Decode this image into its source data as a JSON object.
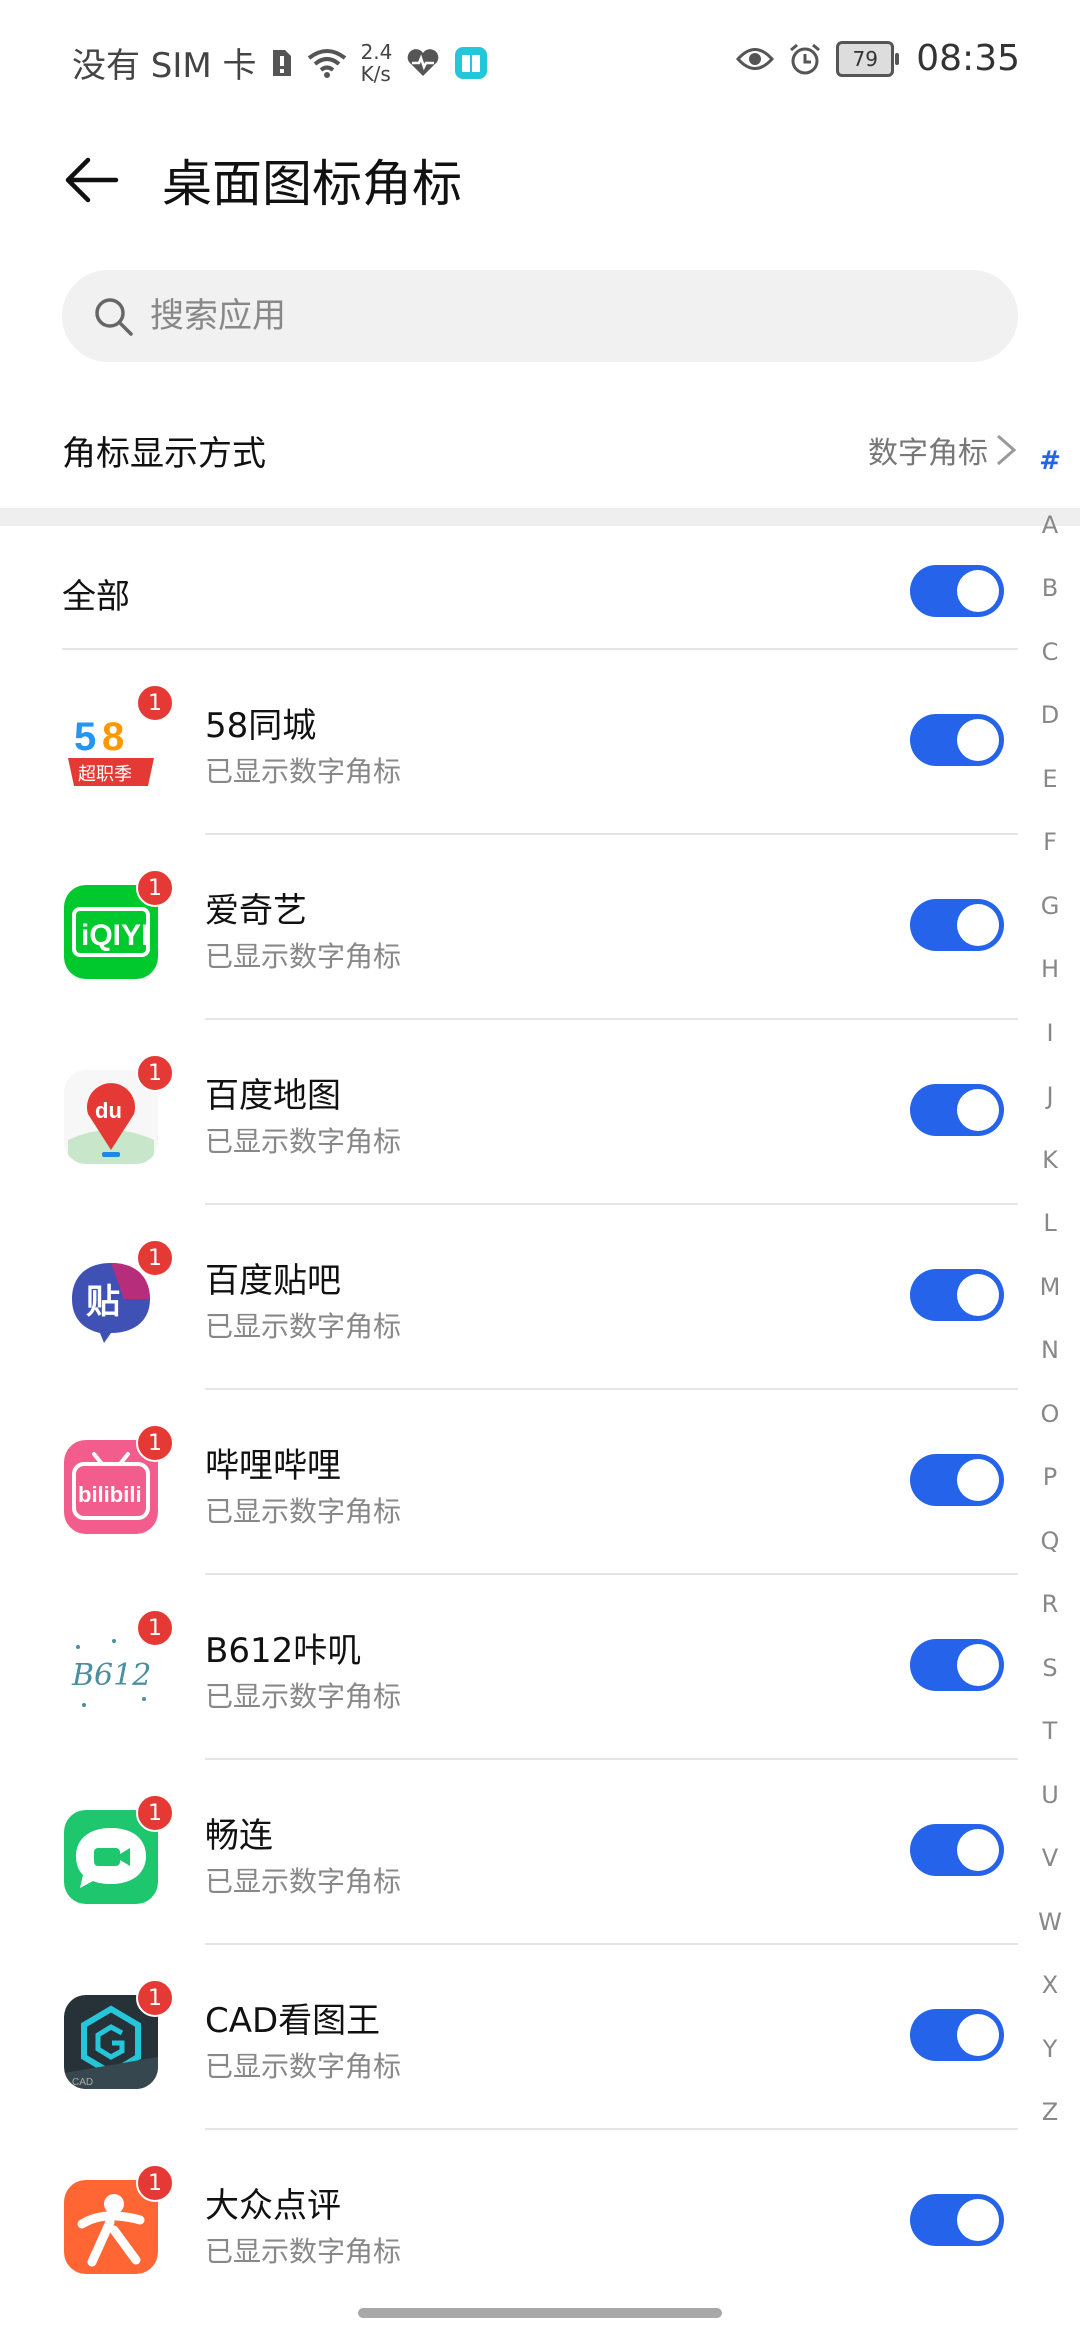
{
  "status": {
    "carrier": "没有 SIM 卡",
    "speed_value": "2.4",
    "speed_unit": "K/s",
    "battery": "79",
    "time": "08:35"
  },
  "header": {
    "title": "桌面图标角标"
  },
  "search": {
    "placeholder": "搜索应用"
  },
  "badge_mode": {
    "label": "角标显示方式",
    "value": "数字角标"
  },
  "all": {
    "label": "全部",
    "enabled": true
  },
  "apps": [
    {
      "name": "58同城",
      "status": "已显示数字角标",
      "badge": "1",
      "icon": "58-tongcheng-icon",
      "enabled": true
    },
    {
      "name": "爱奇艺",
      "status": "已显示数字角标",
      "badge": "1",
      "icon": "iqiyi-icon",
      "enabled": true
    },
    {
      "name": "百度地图",
      "status": "已显示数字角标",
      "badge": "1",
      "icon": "baidu-map-icon",
      "enabled": true
    },
    {
      "name": "百度贴吧",
      "status": "已显示数字角标",
      "badge": "1",
      "icon": "baidu-tieba-icon",
      "enabled": true
    },
    {
      "name": "哔哩哔哩",
      "status": "已显示数字角标",
      "badge": "1",
      "icon": "bilibili-icon",
      "enabled": true
    },
    {
      "name": "B612咔叽",
      "status": "已显示数字角标",
      "badge": "1",
      "icon": "b612-icon",
      "enabled": true
    },
    {
      "name": "畅连",
      "status": "已显示数字角标",
      "badge": "1",
      "icon": "changlian-icon",
      "enabled": true
    },
    {
      "name": "CAD看图王",
      "status": "已显示数字角标",
      "badge": "1",
      "icon": "cad-viewer-icon",
      "enabled": true
    },
    {
      "name": "大众点评",
      "status": "已显示数字角标",
      "badge": "1",
      "icon": "dianping-icon",
      "enabled": true
    }
  ],
  "index_letters": [
    "#",
    "A",
    "B",
    "C",
    "D",
    "E",
    "F",
    "G",
    "H",
    "I",
    "J",
    "K",
    "L",
    "M",
    "N",
    "O",
    "P",
    "Q",
    "R",
    "S",
    "T",
    "U",
    "V",
    "W",
    "X",
    "Y",
    "Z"
  ],
  "colors": {
    "accent": "#2563eb",
    "badge": "#e53935"
  }
}
